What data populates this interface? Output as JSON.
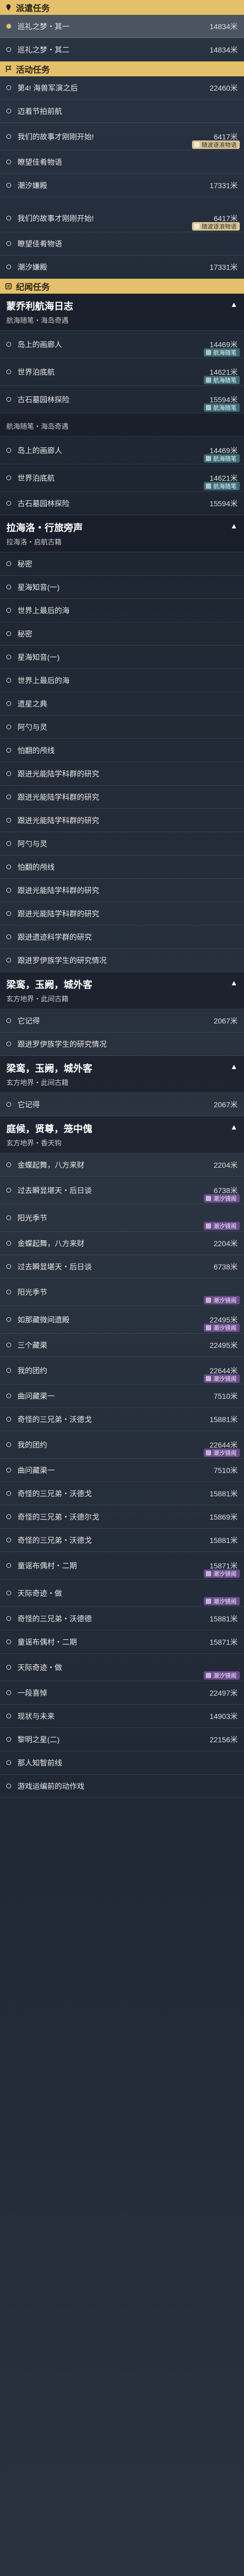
{
  "sections": [
    {
      "title": "派遣任务",
      "icon": "location-pin-icon",
      "rows": [
        {
          "label": "巡礼之梦・其一",
          "dist": "14834米",
          "selected": true
        },
        {
          "label": "巡礼之梦・其二",
          "dist": "14834米"
        }
      ]
    },
    {
      "title": "活动任务",
      "icon": "flag-icon",
      "rows": [
        {
          "label": "第4! 海兽军演之后",
          "dist": "22460米"
        },
        {
          "label": "迈着节拍前航",
          "dist": ""
        },
        {
          "label": "我们的故事才刚刚开始!",
          "dist": "6417米",
          "badge": "随波逐浪物语",
          "badge_style": "gold"
        },
        {
          "label": "瞭望佳肴物语",
          "dist": ""
        },
        {
          "label": "潮汐嫌殿",
          "dist": "17331米"
        }
      ]
    },
    {
      "title": "",
      "icon": "",
      "rows": [
        {
          "label": "我们的故事才刚刚开始!",
          "dist": "6417米",
          "badge": "随波逐浪物语",
          "badge_style": "gold"
        },
        {
          "label": "瞭望佳肴物语",
          "dist": ""
        },
        {
          "label": "潮汐嫌殿",
          "dist": "17331米"
        }
      ]
    },
    {
      "title": "纪闻任务",
      "icon": "scroll-icon",
      "groups": [
        {
          "title": "蒙乔利航海日志",
          "sub": "航海随笔・海岛奇遇",
          "rows": [
            {
              "label": "岛上的画廊人",
              "dist": "14469米",
              "badge": "航海随笔",
              "badge_style": "teal"
            },
            {
              "label": "世界泊底航",
              "dist": "14621米",
              "badge": "航海随笔",
              "badge_style": "teal"
            },
            {
              "label": "古石墓园林探险",
              "dist": "15594米",
              "badge": "航海随笔",
              "badge_style": "teal"
            }
          ]
        },
        {
          "title": "",
          "sub": "航海随笔・海岛奇遇",
          "rows": [
            {
              "label": "岛上的画廊人",
              "dist": "14469米",
              "badge": "航海随笔",
              "badge_style": "teal"
            },
            {
              "label": "世界泊底航",
              "dist": "14621米",
              "badge": "航海随笔",
              "badge_style": "teal"
            },
            {
              "label": "古石墓园林探险",
              "dist": "15594米"
            }
          ]
        },
        {
          "title": "拉海洛・行旅旁声",
          "sub": "拉海洛・启航古籍",
          "rows": [
            {
              "label": "秘密",
              "dist": ""
            },
            {
              "label": "星海知音(一)",
              "dist": ""
            },
            {
              "label": "世界上最后的海",
              "dist": ""
            },
            {
              "label": "秘密",
              "dist": ""
            },
            {
              "label": "星海知音(一)",
              "dist": ""
            },
            {
              "label": "世界上最后的海",
              "dist": ""
            },
            {
              "label": "遗星之典",
              "dist": ""
            },
            {
              "label": "阿勺与灵",
              "dist": ""
            },
            {
              "label": "怕翻的颅线",
              "dist": ""
            },
            {
              "label": "跟进光能陆学科群的研究",
              "dist": ""
            },
            {
              "label": "跟进光能陆学科群的研究",
              "dist": ""
            },
            {
              "label": "跟进光能陆学科群的研究",
              "dist": ""
            },
            {
              "label": "阿勺与灵",
              "dist": ""
            },
            {
              "label": "怕翻的颅线",
              "dist": ""
            },
            {
              "label": "跟进光能陆学科群的研究",
              "dist": ""
            },
            {
              "label": "跟进光能陆学科群的研究",
              "dist": ""
            },
            {
              "label": "跟进遗迹科学群的研究",
              "dist": ""
            },
            {
              "label": "跟进罗伊族学生的研究情况",
              "dist": ""
            }
          ]
        },
        {
          "title": "梁鸾，玉阙，城外客",
          "sub": "玄方地界・此间古籍",
          "rows": [
            {
              "label": "它记得",
              "dist": "2067米"
            },
            {
              "label": "跟进罗伊族学生的研究情况",
              "dist": ""
            }
          ]
        },
        {
          "title": "梁鸾，玉阙，城外客",
          "sub": "玄方地界・此间古籍",
          "rows": [
            {
              "label": "它记得",
              "dist": "2067米"
            }
          ]
        },
        {
          "title": "庭候，贤尊，笼中傀",
          "sub": "玄方地界・香天钩",
          "rows": [
            {
              "label": "金蝶起舞，八方来财",
              "dist": "2204米"
            },
            {
              "label": "过去瞬显堪天・后日谈",
              "dist": "6738米",
              "badge": "潮汐镜阁",
              "badge_style": ""
            },
            {
              "label": "阳光季节",
              "dist": "",
              "badge": "潮汐镜阁",
              "badge_style": ""
            },
            {
              "label": "金蝶起舞，八方来财",
              "dist": "2204米"
            },
            {
              "label": "过去瞬显堪天・后日谈",
              "dist": "6738米"
            },
            {
              "label": "阳光季节",
              "dist": "",
              "badge": "潮汐镜阁",
              "badge_style": ""
            },
            {
              "label": "如那藏微间遗殿",
              "dist": "22495米",
              "badge": "潮汐镜阁",
              "badge_style": ""
            },
            {
              "label": "三个藏渠",
              "dist": "22495米"
            },
            {
              "label": "我的团约",
              "dist": "22644米",
              "badge": "潮汐镜阁",
              "badge_style": ""
            },
            {
              "label": "曲问藏渠一",
              "dist": "7510米"
            },
            {
              "label": "奇怪的三兄弟・沃德戈",
              "dist": "15881米"
            },
            {
              "label": "我的团约",
              "dist": "22644米",
              "badge": "潮汐镜阁",
              "badge_style": ""
            },
            {
              "label": "曲问藏渠一",
              "dist": "7510米"
            },
            {
              "label": "奇怪的三兄弟・沃德戈",
              "dist": "15881米"
            },
            {
              "label": "奇怪的三兄弟・沃德尔戈",
              "dist": "15869米"
            },
            {
              "label": "奇怪的三兄弟・沃德戈",
              "dist": "15881米"
            },
            {
              "label": "童谣布偶村・二期",
              "dist": "15871米",
              "badge": "潮汐镜阁",
              "badge_style": ""
            },
            {
              "label": "天际奇迹・做",
              "dist": "",
              "badge": "潮汐镜阁",
              "badge_style": ""
            },
            {
              "label": "奇怪的三兄弟・沃德德",
              "dist": "15881米"
            },
            {
              "label": "童谣布偶村・二期",
              "dist": "15871米"
            },
            {
              "label": "天际奇迹・做",
              "dist": "",
              "badge": "潮汐镜阁",
              "badge_style": ""
            },
            {
              "label": "一段喜悼",
              "dist": "22497米"
            },
            {
              "label": "现状与未来",
              "dist": "14903米"
            },
            {
              "label": "黎明之星(二)",
              "dist": "22156米"
            },
            {
              "label": "那人知智前线",
              "dist": ""
            },
            {
              "label": "游戏运编前的动作戏",
              "dist": ""
            }
          ]
        }
      ]
    }
  ],
  "colors": {
    "header_bg": "#e4c06a",
    "badge_purple": "#6a4a8a",
    "badge_teal": "#3c6a74",
    "badge_gold": "#d8c69a"
  }
}
